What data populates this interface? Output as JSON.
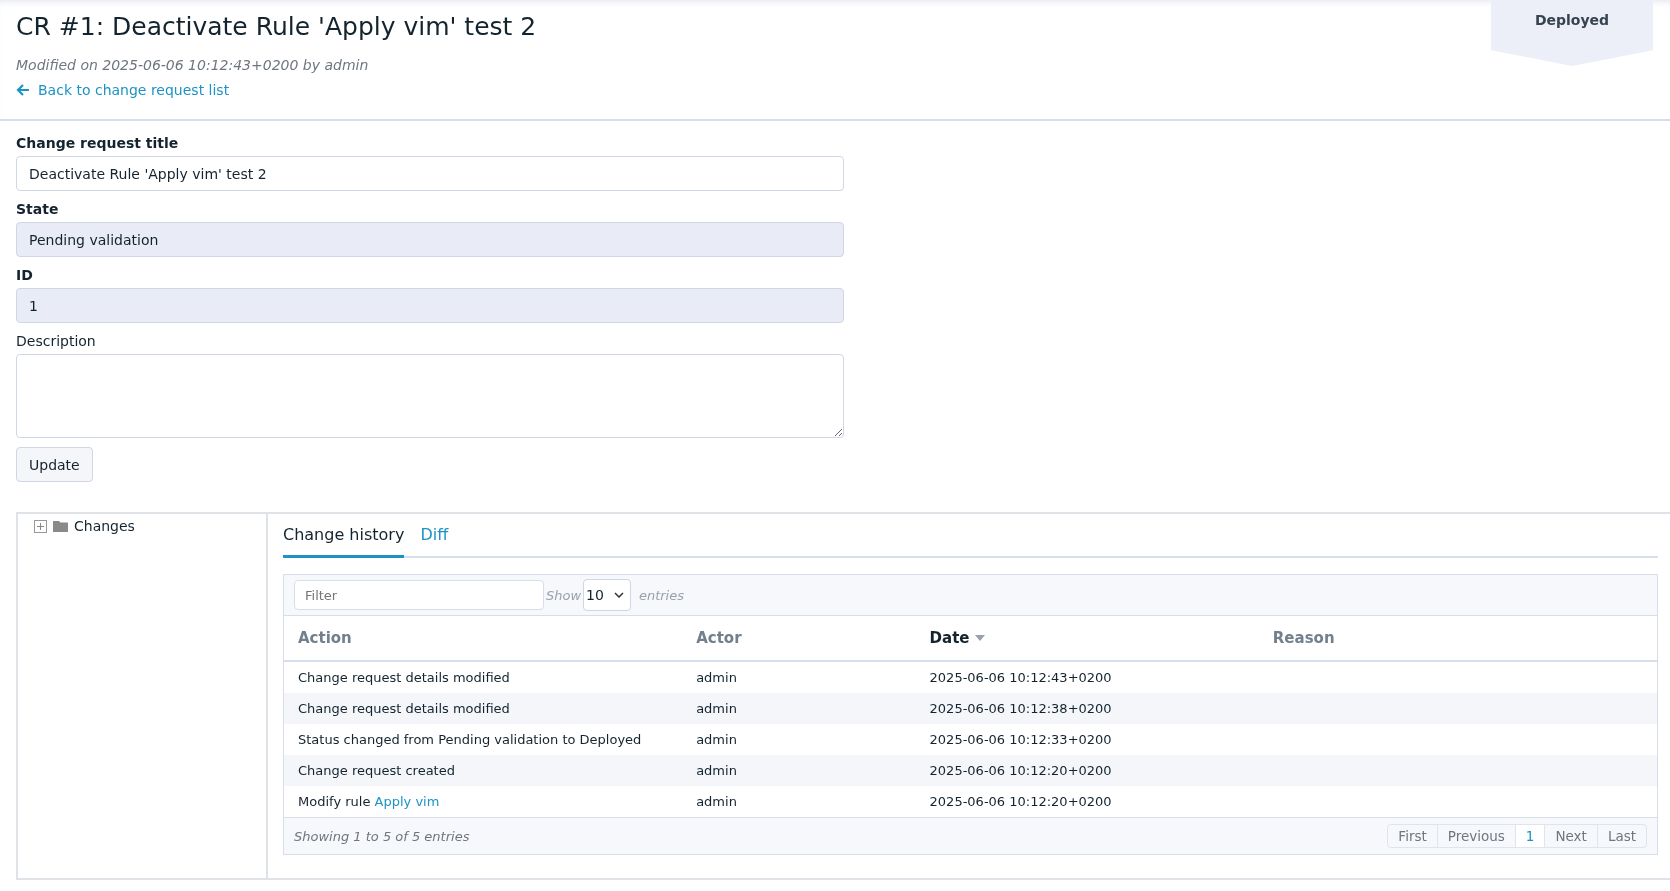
{
  "header": {
    "title": "CR #1: Deactivate Rule 'Apply vim' test 2",
    "modified": "Modified on 2025-06-06 10:12:43+0200 by admin",
    "back_link": "Back to change request list",
    "status_badge": "Deployed"
  },
  "form": {
    "fields": [
      {
        "label": "Change request title",
        "kind": "input",
        "value": "Deactivate Rule 'Apply vim' test 2",
        "readonly": false,
        "bold_label": true
      },
      {
        "label": "State",
        "kind": "input",
        "value": "Pending validation",
        "readonly": true,
        "bold_label": true
      },
      {
        "label": "ID",
        "kind": "input",
        "value": "1",
        "readonly": true,
        "bold_label": true
      },
      {
        "label": "Description",
        "kind": "textarea",
        "readonly": false,
        "bold_label": false
      }
    ],
    "button": "Update"
  },
  "tree": {
    "items": [
      {
        "label": "Changes",
        "expanded": false
      }
    ]
  },
  "tabs": [
    {
      "label": "Change history",
      "selected": true
    },
    {
      "label": "Diff",
      "selected": false
    }
  ],
  "table": {
    "filter_placeholder": "Filter",
    "show_label": "Show",
    "page_size": "10",
    "entries_label": "entries",
    "columns": [
      {
        "label": "Action",
        "sorted": false
      },
      {
        "label": "Actor",
        "sorted": false
      },
      {
        "label": "Date",
        "sorted": true
      },
      {
        "label": "Reason",
        "sorted": false
      }
    ],
    "rows": [
      {
        "action": "Change request details modified",
        "actor": "admin",
        "date": "2025-06-06 10:12:43+0200"
      },
      {
        "action": "Change request details modified",
        "actor": "admin",
        "date": "2025-06-06 10:12:38+0200"
      },
      {
        "action": "Status changed from Pending validation to Deployed",
        "actor": "admin",
        "date": "2025-06-06 10:12:33+0200"
      },
      {
        "action": "Change request created",
        "actor": "admin",
        "date": "2025-06-06 10:12:20+0200"
      },
      {
        "action": "Modify rule ",
        "action_link": "Apply vim",
        "actor": "admin",
        "date": "2025-06-06 10:12:20+0200"
      }
    ],
    "info": "Showing 1 to 5 of 5 entries",
    "pagination": [
      {
        "label": "First",
        "selected": false
      },
      {
        "label": "Previous",
        "selected": false
      },
      {
        "label": "1",
        "selected": true
      },
      {
        "label": "Next",
        "selected": false
      },
      {
        "label": "Last",
        "selected": false
      }
    ]
  }
}
